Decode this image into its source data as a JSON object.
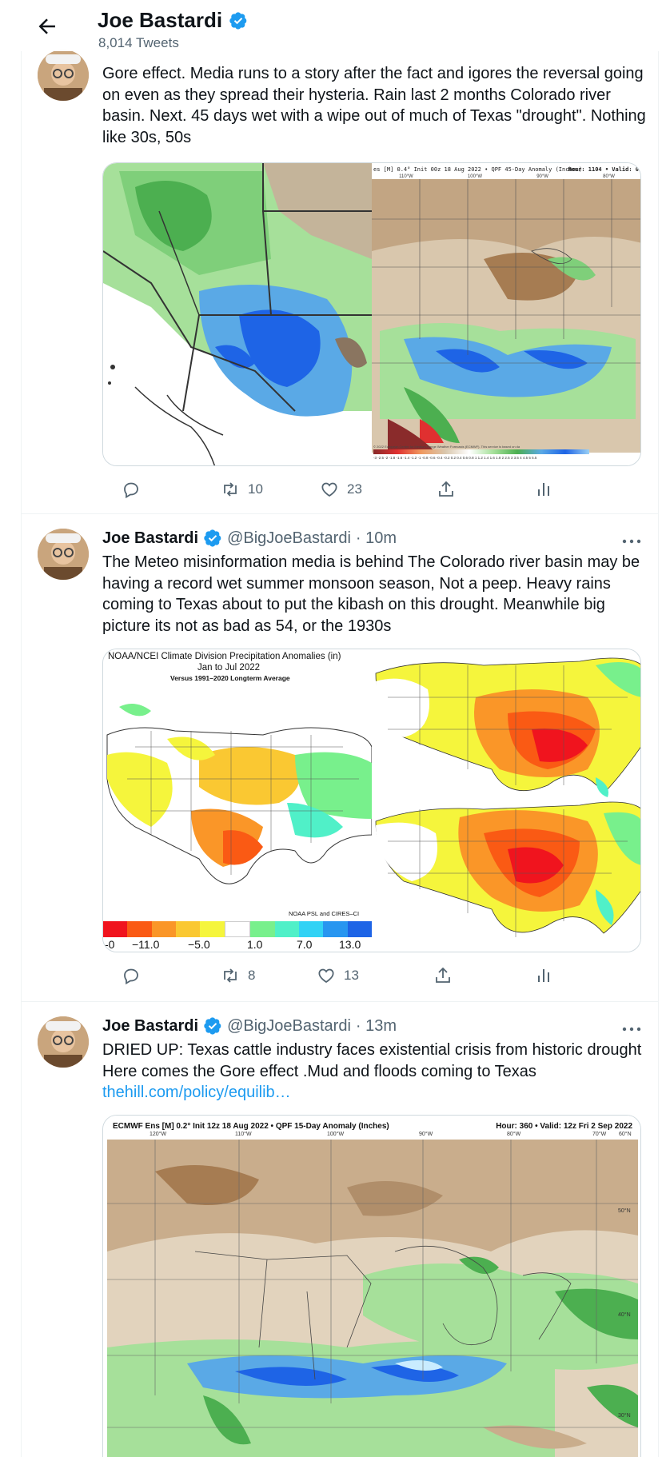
{
  "header": {
    "name": "Joe Bastardi",
    "tweet_count": "8,014 Tweets"
  },
  "tweets": [
    {
      "text": "Gore effect. Media runs to a story after the fact and igores the reversal going on even as they spread their hysteria.  Rain last 2 months Colorado river basin. Next. 45 days wet with a wipe out of much of Texas \"drought\".  Nothing like 30s, 50s",
      "media": {
        "right_title": "es [M] 0.4° Init 00z 18 Aug 2022 • QPF 45-Day Anomaly (Inches)",
        "right_hour": "Hour: 1104 • Valid: 0",
        "right_lon_labels": [
          "110°W",
          "100°W",
          "90°W",
          "80°W"
        ],
        "right_scale": "-3 -2.5 -2 -1.8 -1.6 -1.4 -1.2 -1 -0.8 -0.6 -0.4 -0.2 0.2 0.4 0.6 0.8 1 1.2 1.4 1.6 1.8 2 2.5 3 3.5 4 4.5 5 5.5",
        "right_credit": "© 2022 European Centre for Medium-Range Weather Forecasts (ECMWF). This service is based on da"
      },
      "retweets": "10",
      "likes": "23"
    },
    {
      "name": "Joe Bastardi",
      "handle": "@BigJoeBastardi",
      "time": "· 10m",
      "text": "The Meteo misinformation media is behind   The Colorado river basin may be having a record wet summer monsoon season, Not a peep.  Heavy rains coming to Texas about to put the kibash on this drought.  Meanwhile big picture its not as bad as  54, or the 1930s",
      "media": {
        "title_line1": "NOAA/NCEI Climate Division Precipitation Anomalies (in)",
        "title_line2": "Jan to Jul 2022",
        "title_line3": "Versus 1991–2020 Longterm Average",
        "credit": "NOAA PSL and CIRES–CI",
        "scale_labels": [
          "-0",
          "−11.0",
          "−5.0",
          "1.0",
          "7.0",
          "13.0"
        ],
        "scale_colors": [
          "#f0141e",
          "#fa5a14",
          "#fa9628",
          "#fac832",
          "#f5f53c",
          "#ffffff",
          "#78f08c",
          "#50f0c8",
          "#32d2f5",
          "#2896f0",
          "#1e64e6"
        ]
      },
      "retweets": "8",
      "likes": "13"
    },
    {
      "name": "Joe Bastardi",
      "handle": "@BigJoeBastardi",
      "time": "· 13m",
      "text": "DRIED UP: Texas cattle industry faces existential crisis from historic drought     Here comes the Gore effect .Mud and floods coming to Texas",
      "link": "thehill.com/policy/equilib…",
      "media": {
        "title": "ECMWF Ens [M] 0.2° Init 12z 18 Aug 2022 • QPF 15-Day Anomaly (Inches)",
        "hour": "Hour: 360 • Valid: 12z Fri 2 Sep 2022",
        "lon_labels": [
          "120°W",
          "110°W",
          "100°W",
          "90°W",
          "80°W",
          "70°W",
          "60°N"
        ],
        "lat_labels": [
          "50°N",
          "40°N",
          "30°N"
        ]
      }
    }
  ],
  "colors": {
    "accent": "#1d9bf0",
    "muted_text": "#536471",
    "border": "#cfd9de"
  },
  "icons": [
    "back-arrow-icon",
    "verified-badge-icon",
    "reply-icon",
    "retweet-icon",
    "like-icon",
    "share-icon",
    "analytics-icon",
    "more-icon"
  ]
}
